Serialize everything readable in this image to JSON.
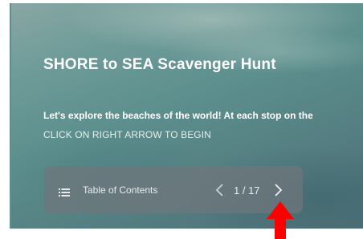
{
  "slide": {
    "title": "SHORE to SEA Scavenger Hunt",
    "intro": "Let's explore the beaches of the world! At each stop on the",
    "cta": "CLICK ON RIGHT ARROW TO BEGIN"
  },
  "nav": {
    "toc_label": "Table of Contents",
    "page_indicator": "1 / 17",
    "prev_icon": "chevron-left",
    "next_icon": "chevron-right",
    "menu_icon": "list"
  },
  "annotation": {
    "icon": "up-arrow",
    "color": "#ff0000"
  },
  "colors": {
    "navbar_bg": "#70767b",
    "text": "#ffffff"
  }
}
